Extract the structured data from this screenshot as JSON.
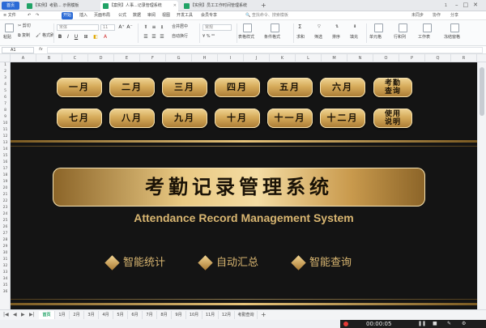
{
  "tabs": {
    "home": "首页",
    "items": [
      {
        "label": "【实例】考勤... 示例模板",
        "active": false
      },
      {
        "label": "【案例】人事...记录管理系统",
        "active": true
      },
      {
        "label": "【实例】员工工作时间管理系统",
        "active": false
      }
    ],
    "page_indicator": "1"
  },
  "menu": {
    "file": "文件",
    "items": [
      "开始",
      "插入",
      "页面布局",
      "公式",
      "数据",
      "审阅",
      "视图",
      "开发工具",
      "会员专享"
    ],
    "active": "开始",
    "search": "查找命令、搜索模板",
    "right": [
      "未同步",
      "协作",
      "分享"
    ]
  },
  "ribbon": {
    "paste": "粘贴",
    "cut": "剪切",
    "copy": "复制",
    "format_painter": "格式刷",
    "font": "宋体",
    "font_size": "11",
    "merge": "合并居中",
    "wrap": "自动换行",
    "number_format": "常规",
    "cond_format": "条件格式",
    "table_style": "表格样式",
    "sum": "求和",
    "filter": "筛选",
    "sort": "排序",
    "fill": "填充",
    "cell": "单元格",
    "row_col": "行和列",
    "worksheet": "工作表",
    "freeze": "冻结窗格"
  },
  "formula_bar": {
    "cell_ref": "A1",
    "fx": "fx",
    "value": ""
  },
  "columns": [
    "A",
    "B",
    "C",
    "D",
    "E",
    "F",
    "G",
    "H",
    "I",
    "J",
    "K",
    "L",
    "M",
    "N",
    "O",
    "P",
    "Q",
    "R"
  ],
  "rows": [
    "1",
    "2",
    "3",
    "4",
    "5",
    "6",
    "7",
    "8",
    "9",
    "10",
    "11",
    "12",
    "13",
    "14",
    "15",
    "16",
    "17",
    "18",
    "19",
    "20",
    "21",
    "22",
    "23",
    "24",
    "25",
    "26",
    "27",
    "28",
    "29",
    "30",
    "31",
    "32",
    "33",
    "34",
    "35",
    "36"
  ],
  "months_row1": [
    "一月",
    "二月",
    "三月",
    "四月",
    "五月",
    "六月"
  ],
  "months_row2": [
    "七月",
    "八月",
    "九月",
    "十月",
    "十一月",
    "十二月"
  ],
  "attendance_query": {
    "line1": "考勤",
    "line2": "查询"
  },
  "instructions": {
    "line1": "使用",
    "line2": "说明"
  },
  "title": "考勤记录管理系统",
  "subtitle": "Attendance Record Management System",
  "features": [
    "智能统计",
    "自动汇总",
    "智能查询"
  ],
  "sheet_tabs": [
    "首页",
    "1月",
    "2月",
    "3月",
    "4月",
    "5月",
    "6月",
    "7月",
    "8月",
    "9月",
    "10月",
    "11月",
    "12月",
    "考勤查询"
  ],
  "active_sheet": "首页",
  "video": {
    "time": "00:00:05",
    "controls": [
      "❚❚",
      "■",
      "✎",
      "⚙"
    ]
  },
  "colors": {
    "gold": "#d9b671",
    "sheet_bg": "#141414",
    "accent_blue": "#2b6bd6",
    "excel_green": "#21a366"
  }
}
